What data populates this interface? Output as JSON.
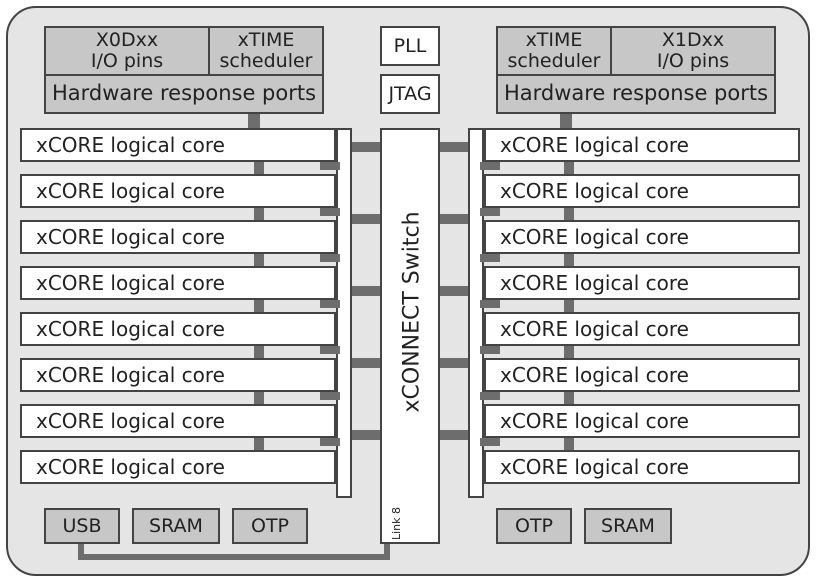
{
  "tile_left": {
    "io_pins": "X0Dxx\nI/O pins",
    "scheduler": "xTIME\nscheduler",
    "hrp": "Hardware response ports",
    "cores": [
      "xCORE logical core",
      "xCORE logical core",
      "xCORE logical core",
      "xCORE logical core",
      "xCORE logical core",
      "xCORE logical core",
      "xCORE logical core",
      "xCORE logical core"
    ],
    "mem": [
      "USB",
      "SRAM",
      "OTP"
    ]
  },
  "tile_right": {
    "io_pins": "X1Dxx\nI/O pins",
    "scheduler": "xTIME\nscheduler",
    "hrp": "Hardware response ports",
    "cores": [
      "xCORE logical core",
      "xCORE logical core",
      "xCORE logical core",
      "xCORE logical core",
      "xCORE logical core",
      "xCORE logical core",
      "xCORE logical core",
      "xCORE logical core"
    ],
    "mem": [
      "OTP",
      "SRAM"
    ]
  },
  "center": {
    "pll": "PLL",
    "jtag": "JTAG",
    "switch": "xCONNECT Switch",
    "link": "Link 8"
  }
}
